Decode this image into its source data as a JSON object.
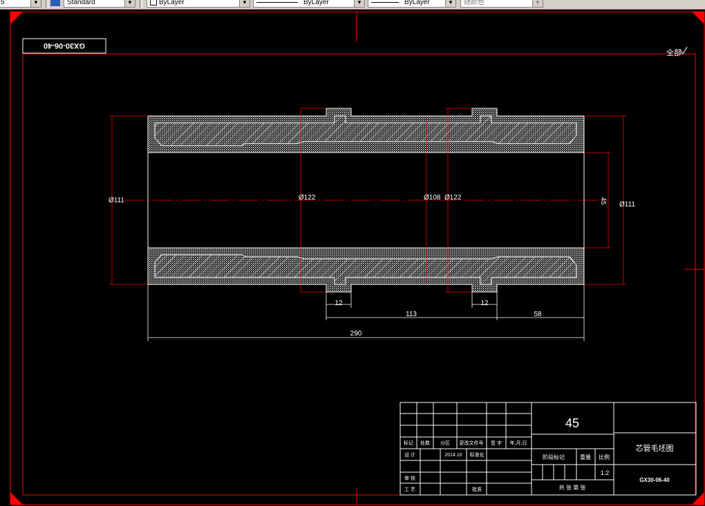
{
  "toolbar": {
    "textstyle": "5",
    "dimstyle": "Standard",
    "layer": "ByLayer",
    "linetype": "ByLayer",
    "lineweight": "ByLayer",
    "plotstyle": "随颜色"
  },
  "drawing": {
    "drawing_number_box": "GX30-06-40",
    "roughness_note": "全部",
    "dims": {
      "dia_left": "Ø111",
      "dia_122_a": "Ø122",
      "dia_108": "Ø108",
      "dia_122_b": "Ø122",
      "dim_45": "45",
      "dia_right": "Ø111",
      "dim_12_a": "12",
      "dim_12_b": "12",
      "dim_113": "113",
      "dim_58": "58",
      "dim_290": "290"
    }
  },
  "title_block": {
    "material": "45",
    "part_name": "芯管毛坯图",
    "drawing_number": "GX30-06-40",
    "scale": "1:2",
    "revision_row": [
      "标记",
      "处数",
      "分区",
      "更改文件号",
      "签 字",
      "年,月,日"
    ],
    "designer_label": "设 计",
    "date": "2014.10",
    "standardize": "标准化",
    "stage_mark": "阶段标记",
    "weight": "重量",
    "scale_label": "比例",
    "review": "审 核",
    "process": "工 艺",
    "approve": "批准",
    "sheets": "共  张  第  张"
  }
}
